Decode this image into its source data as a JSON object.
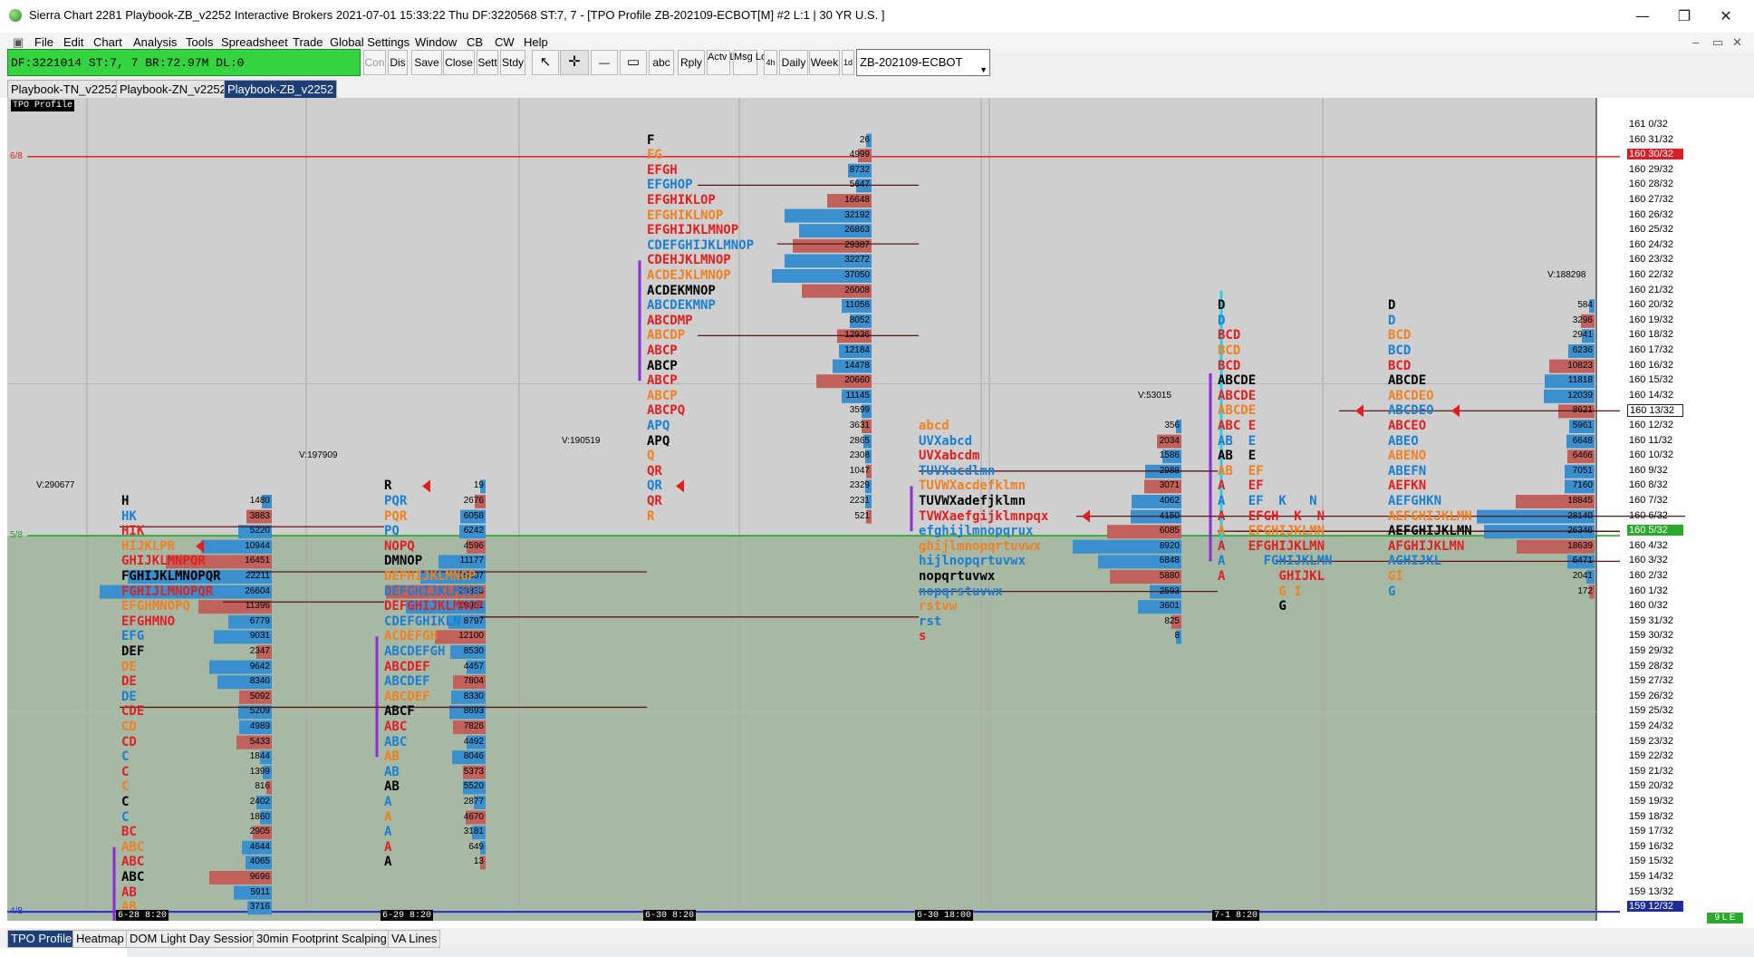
{
  "window": {
    "title": "Sierra Chart 2281 Playbook-ZB_v2252  Interactive Brokers 2021-07-01  15:33:22 Thu  DF:3220568  ST:7, 7 - [TPO Profile ZB-202109-ECBOT[M]  #2 L:1 | 30 YR U.S. ]",
    "minimize": "—",
    "restore": "❐",
    "close": "✕"
  },
  "menu": [
    "File",
    "Edit",
    "Chart",
    "Analysis",
    "Tools",
    "Spreadsheet",
    "Trade",
    "Global Settings",
    "Window",
    "CB",
    "CW",
    "Help"
  ],
  "status": "DF:3221014  ST:7, 7  BR:72.97M  DL:0",
  "toolbar": {
    "con": "Con",
    "dis": "Dis",
    "save": "Save",
    "close": "Close",
    "sett": "Sett",
    "stdy": "Stdy",
    "abc": "abc",
    "rply": "Rply",
    "actv": "Actv Log",
    "msg": "Msg Log",
    "4h": "4h",
    "daily": "Daily",
    "week": "Week",
    "1d": "1d"
  },
  "symbol": "ZB-202109-ECBOT",
  "chart_tabs": [
    "Playbook-TN_v2252",
    "Playbook-ZN_v2252",
    "Playbook-ZB_v2252"
  ],
  "bottom_tabs": [
    "TPO Profile",
    "Heatmap",
    "DOM Light Day Session",
    "30min Footprint Scalping",
    "VA Lines"
  ],
  "chart": {
    "tag": "TPO Profile",
    "vlabels": [
      "V:290677",
      "V:197909",
      "V:190519",
      "V:53015",
      "V:188298"
    ],
    "level_tags": [
      "6/8",
      "5/8",
      "4/8"
    ],
    "dates": [
      "6-28  8:20",
      "6-29  8:20",
      "6-30  8:20",
      "6-30  18:00",
      "7-1  8:20"
    ],
    "corner": "9 L E"
  },
  "chart_data": {
    "type": "table",
    "prices": [
      "161 0/32",
      "160 31/32",
      "160 30/32",
      "160 29/32",
      "160 28/32",
      "160 27/32",
      "160 26/32",
      "160 25/32",
      "160 24/32",
      "160 23/32",
      "160 22/32",
      "160 21/32",
      "160 20/32",
      "160 19/32",
      "160 18/32",
      "160 17/32",
      "160 16/32",
      "160 15/32",
      "160 14/32",
      "160 13/32",
      "160 12/32",
      "160 11/32",
      "160 10/32",
      "160 9/32",
      "160 8/32",
      "160 7/32",
      "160 6/32",
      "160 5/32",
      "160 4/32",
      "160 3/32",
      "160 2/32",
      "160 1/32",
      "160 0/32",
      "159 31/32",
      "159 30/32",
      "159 29/32",
      "159 28/32",
      "159 27/32",
      "159 26/32",
      "159 25/32",
      "159 24/32",
      "159 23/32",
      "159 22/32",
      "159 21/32",
      "159 20/32",
      "159 19/32",
      "159 18/32",
      "159 17/32",
      "159 16/32",
      "159 15/32",
      "159 14/32",
      "159 13/32",
      "159 12/32"
    ],
    "profiles": [
      {
        "start": 25,
        "letters": [
          "H",
          "HK",
          "HIK",
          "HIJKLPR",
          "GHIJKLMNPQR",
          "FGHIJKLMNOPQR",
          "FGHIJLMNOPQR",
          "EFGHMNOPQ",
          "EFGHMNO",
          "EFG",
          "DEF",
          "DE",
          "DE",
          "DE",
          "CDE",
          "CD",
          "CD",
          "C",
          "C",
          "C",
          "C",
          "C",
          "BC",
          "ABC",
          "ABC",
          "ABC",
          "AB",
          "AB"
        ],
        "vols": [
          "1480",
          "3883",
          "5220",
          "10944",
          "16451",
          "22211",
          "26604",
          "11396",
          "6779",
          "9031",
          "2347",
          "9642",
          "8340",
          "5092",
          "5209",
          "4989",
          "5433",
          "1844",
          "1399",
          "816",
          "2402",
          "1860",
          "2905",
          "4644",
          "4065",
          "9696",
          "5911",
          "3716"
        ]
      },
      {
        "start": 24,
        "letters": [
          "R",
          "PQR",
          "PQR",
          "PQ",
          "NOPQ",
          "DMNOP",
          "DEFHIJKLMNOP",
          "DEFGHIJKLMNOP",
          "DEFGHIJKLMNOP",
          "CDEFGHIKLN",
          "ACDEFGH",
          "ABCDEFGH",
          "ABCDEF",
          "ABCDEF",
          "ABCDEF",
          "ABCF",
          "ABC",
          "ABC",
          "AB",
          "AB",
          "AB",
          "A",
          "A",
          "A",
          "A",
          "A"
        ],
        "vols": [
          "19",
          "2676",
          "6058",
          "6242",
          "4596",
          "11177",
          "15607",
          "23833",
          "18961",
          "8797",
          "12100",
          "8530",
          "4457",
          "7804",
          "8330",
          "8693",
          "7826",
          "4492",
          "8046",
          "5373",
          "5520",
          "2877",
          "4670",
          "3181",
          "649",
          "13"
        ]
      },
      {
        "start": 1,
        "letters": [
          "F",
          "FG",
          "EFGH",
          "EFGHOP",
          "EFGHIKLOP",
          "EFGHIKLNOP",
          "EFGHIJKLMNOP",
          "CDEFGHIJKLMNOP",
          "CDEHJKLMNOP",
          "ACDEJKLMNOP",
          "ACDEKMNOP",
          "ABCDEKMNP",
          "ABCDMP",
          "ABCDP",
          "ABCP",
          "ABCP",
          "ABCP",
          "ABCP",
          "ABCPQ",
          "APQ",
          "APQ",
          "Q",
          "QR",
          "QR",
          "QR",
          "R"
        ],
        "vols": [
          "26",
          "4999",
          "8732",
          "5647",
          "16648",
          "32192",
          "26863",
          "29387",
          "32272",
          "37050",
          "26008",
          "11056",
          "8052",
          "12936",
          "12184",
          "14478",
          "20660",
          "11145",
          "3599",
          "3631",
          "2865",
          "2308",
          "1047",
          "2329",
          "2231",
          "521"
        ]
      },
      {
        "start": 20,
        "letters": [
          "abcd",
          "UVXabcd",
          "UVXabcdm",
          "TUVXacdlmn",
          "TUVWXacdefklmn",
          "TUVWXadefjklmn",
          "TVWXaefgijklmnpqx",
          "efghijlmnopqrux",
          "ghijlmnopqrtuvwx",
          "hijlnopqrtuvwx",
          "nopqrtuvwx",
          "nopqrstuvwx",
          "rstvw",
          "rst",
          "s"
        ],
        "vols": [
          "356",
          "2034",
          "1586",
          "2988",
          "3071",
          "4062",
          "4150",
          "6085",
          "8920",
          "6848",
          "5880",
          "2593",
          "3601",
          "825",
          "8"
        ]
      },
      {
        "start": 12,
        "letters": [
          "D",
          "D",
          "BCD",
          "BCD",
          "BCD",
          "ABCDE",
          "ABCDE",
          "ABCDE",
          "ABC E",
          "AB  E",
          "AB  E",
          "AB  EF",
          "A   EF",
          "A   EF  K   N",
          "A   EFGH  K  N",
          "A   EFGHIJKLMN",
          "A   EFGHIJKLMN",
          "A     FGHIJKLMN",
          "A       GHIJKL",
          "        G I",
          "        G"
        ],
        "vols": []
      },
      {
        "start": 12,
        "letters": [
          "D",
          "D",
          "BCD",
          "BCD",
          "BCD",
          "ABCDE",
          "ABCDEO",
          "ABCDEO",
          "ABCEO",
          "ABEO",
          "ABENO",
          "ABEFN",
          "AEFKN",
          "AEFGHKN",
          "AEFGHIJKLMN",
          "AEFGHIJKLMN",
          "AFGHIJKLMN",
          "AGHIJKL",
          "GI",
          "G"
        ],
        "vols": [
          "584",
          "3296",
          "2941",
          "6236",
          "10823",
          "11818",
          "12039",
          "8621",
          "5961",
          "6648",
          "6466",
          "7051",
          "7160",
          "18845",
          "28140",
          "26346",
          "18639",
          "6471",
          "2041",
          "172"
        ]
      }
    ]
  }
}
